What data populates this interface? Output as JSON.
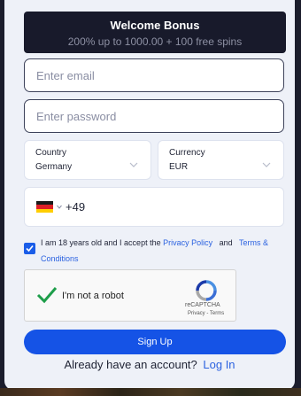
{
  "bonus": {
    "title": "Welcome Bonus",
    "subtitle": "200% up to 1000.00 + 100 free spins"
  },
  "email": {
    "placeholder": "Enter email"
  },
  "password": {
    "placeholder": "Enter password"
  },
  "country": {
    "label": "Country",
    "value": "Germany"
  },
  "currency": {
    "label": "Currency",
    "value": "EUR"
  },
  "phone": {
    "flag_icon": "germany-flag-icon",
    "dial_code": "+49"
  },
  "terms": {
    "checked": true,
    "text": "I am 18 years old and I accept the",
    "privacy_link": "Privacy Policy",
    "and": "and",
    "terms_link": "Terms & Conditions"
  },
  "recaptcha": {
    "label": "I'm not a robot",
    "brand": "reCAPTCHA",
    "links": "Privacy - Terms",
    "checked": true
  },
  "signup_label": "Sign Up",
  "account": {
    "question": "Already have an account?",
    "login_link": "Log In"
  },
  "colors": {
    "accent": "#1553e6",
    "link": "#2b62e0",
    "bonus_bg": "#181a2b",
    "panel_bg": "#eef1f8",
    "check_green": "#1e9e4a"
  }
}
